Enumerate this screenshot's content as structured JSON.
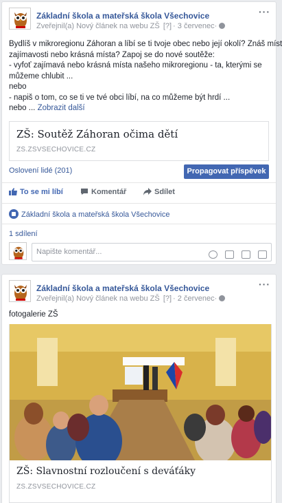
{
  "posts": [
    {
      "page_name": "Základní škola a mateřská škola Všechovice",
      "meta_prefix": "Zveřejnil(a) Nový článek na webu ZŠ",
      "meta_q": "[?]",
      "meta_date": "3 červenec",
      "text_lines": [
        "Bydlíš v mikroregionu Záhoran a líbí se ti tvoje obec nebo její okolí? Znáš místní",
        "zajímavosti nebo krásná místa? Zapoj se do nové soutěže:",
        "- vyfoť zajímavá nebo krásná místa našeho mikroregionu - ta, kterými se",
        "můžeme chlubit ...",
        "nebo",
        "- napiš o tom, co se ti ve tvé obci líbí, na co můžeme být hrdí ..."
      ],
      "last_line": "nebo ...",
      "see_more": "Zobrazit další",
      "link_title": "ZŠ: Soutěž Záhoran očima dětí",
      "link_domain": "ZS.ZSVSECHOVICE.CZ",
      "reach": "Oslovení lidé (201)",
      "promote": "Propagovat příspěvek",
      "like": "To se mi líbí",
      "comment": "Komentář",
      "share": "Sdílet",
      "liked_by": "Základní škola a mateřská škola Všechovice",
      "shares": "1 sdílení",
      "comment_placeholder": "Napište komentář..."
    },
    {
      "page_name": "Základní škola a mateřská škola Všechovice",
      "meta_prefix": "Zveřejnil(a) Nový článek na webu ZŠ",
      "meta_q": "[?]",
      "meta_date": "2 červenec",
      "caption": "fotogalerie ZŠ",
      "link_title": "ZŠ: Slavnostní rozloučení s deváťáky",
      "link_domain": "ZS.ZSVSECHOVICE.CZ"
    }
  ],
  "colors": {
    "link": "#365899",
    "button": "#4267b2",
    "muted": "#90949c"
  },
  "icons": [
    "owl-logo",
    "globe-icon",
    "more-icon",
    "like-icon",
    "comment-icon",
    "share-icon",
    "emoji-icon",
    "camera-icon",
    "gif-icon",
    "sticker-icon"
  ]
}
